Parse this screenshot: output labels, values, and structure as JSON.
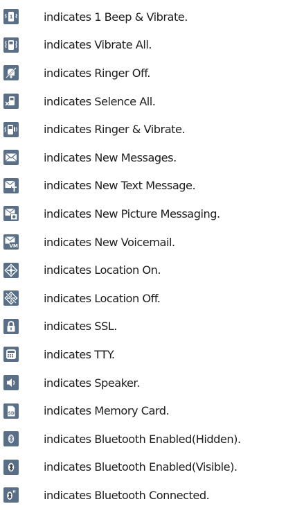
{
  "colors": {
    "icon_bg": "#5a6f86",
    "icon_fg": "#ffffff",
    "text": "#1d1d1d"
  },
  "legend": [
    {
      "icon": "beep-vibrate-icon",
      "label": "indicates 1 Beep & Vibrate."
    },
    {
      "icon": "vibrate-all-icon",
      "label": "indicates Vibrate All."
    },
    {
      "icon": "ringer-off-icon",
      "label": "indicates Ringer Off."
    },
    {
      "icon": "silence-all-icon",
      "label": "indicates Selence All."
    },
    {
      "icon": "ringer-vibrate-icon",
      "label": "indicates Ringer & Vibrate."
    },
    {
      "icon": "new-messages-icon",
      "label": "indicates New Messages."
    },
    {
      "icon": "new-text-message-icon",
      "label": "indicates New Text Message."
    },
    {
      "icon": "new-picture-messaging-icon",
      "label": "indicates New Picture Messaging."
    },
    {
      "icon": "new-voicemail-icon",
      "label": "indicates New Voicemail."
    },
    {
      "icon": "location-on-icon",
      "label": "indicates Location On."
    },
    {
      "icon": "location-off-icon",
      "label": "indicates Location Off."
    },
    {
      "icon": "ssl-lock-icon",
      "label": "indicates SSL."
    },
    {
      "icon": "tty-icon",
      "label": "indicates TTY."
    },
    {
      "icon": "speaker-icon",
      "label": "indicates Speaker."
    },
    {
      "icon": "memory-card-icon",
      "label": "indicates Memory Card."
    },
    {
      "icon": "bluetooth-hidden-icon",
      "label": "indicates Bluetooth Enabled(Hidden)."
    },
    {
      "icon": "bluetooth-visible-icon",
      "label": "indicates Bluetooth Enabled(Visible)."
    },
    {
      "icon": "bluetooth-connected-icon",
      "label": "indicates Bluetooth Connected."
    }
  ]
}
